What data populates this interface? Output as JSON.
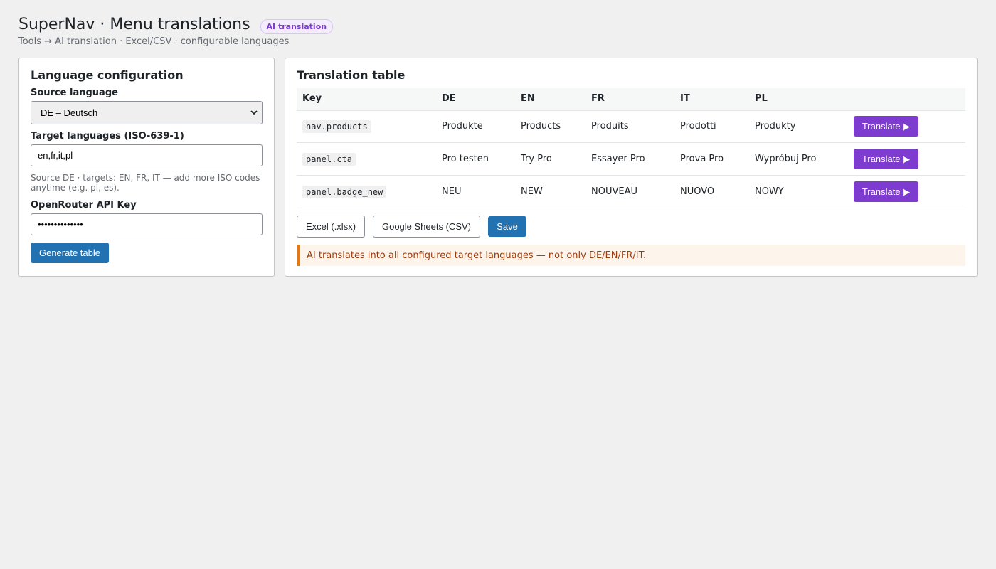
{
  "header": {
    "title": "SuperNav · Menu translations",
    "badge": "AI translation",
    "breadcrumb": "Tools → AI translation · Excel/CSV · configurable languages"
  },
  "config": {
    "heading": "Language configuration",
    "source_label": "Source language",
    "source_value": "DE – Deutsch",
    "target_label": "Target languages (ISO-639-1)",
    "target_value": "en,fr,it,pl",
    "help": "Source DE · targets: EN, FR, IT — add more ISO codes anytime (e.g. pl, es).",
    "api_label": "OpenRouter API Key",
    "api_value": "••••••••••••••",
    "generate_button": "Generate table"
  },
  "table": {
    "heading": "Translation table",
    "columns": [
      "Key",
      "DE",
      "EN",
      "FR",
      "IT",
      "PL"
    ],
    "rows": [
      {
        "key": "nav.products",
        "de": "Produkte",
        "en": "Products",
        "fr": "Produits",
        "it": "Prodotti",
        "pl": "Produkty"
      },
      {
        "key": "panel.cta",
        "de": "Pro testen",
        "en": "Try Pro",
        "fr": "Essayer Pro",
        "it": "Prova Pro",
        "pl": "Wypróbuj Pro"
      },
      {
        "key": "panel.badge_new",
        "de": "NEU",
        "en": "NEW",
        "fr": "NOUVEAU",
        "it": "NUOVO",
        "pl": "NOWY"
      }
    ],
    "translate_button": "Translate ▶",
    "excel_button": "Excel (.xlsx)",
    "sheets_button": "Google Sheets (CSV)",
    "save_button": "Save",
    "notice": "AI translates into all configured target languages — not only DE/EN/FR/IT."
  },
  "colors": {
    "primary": "#2271b1",
    "accent_purple": "#7e3bd0",
    "notice_border": "#dd7c19",
    "background": "#f0f0f1"
  }
}
